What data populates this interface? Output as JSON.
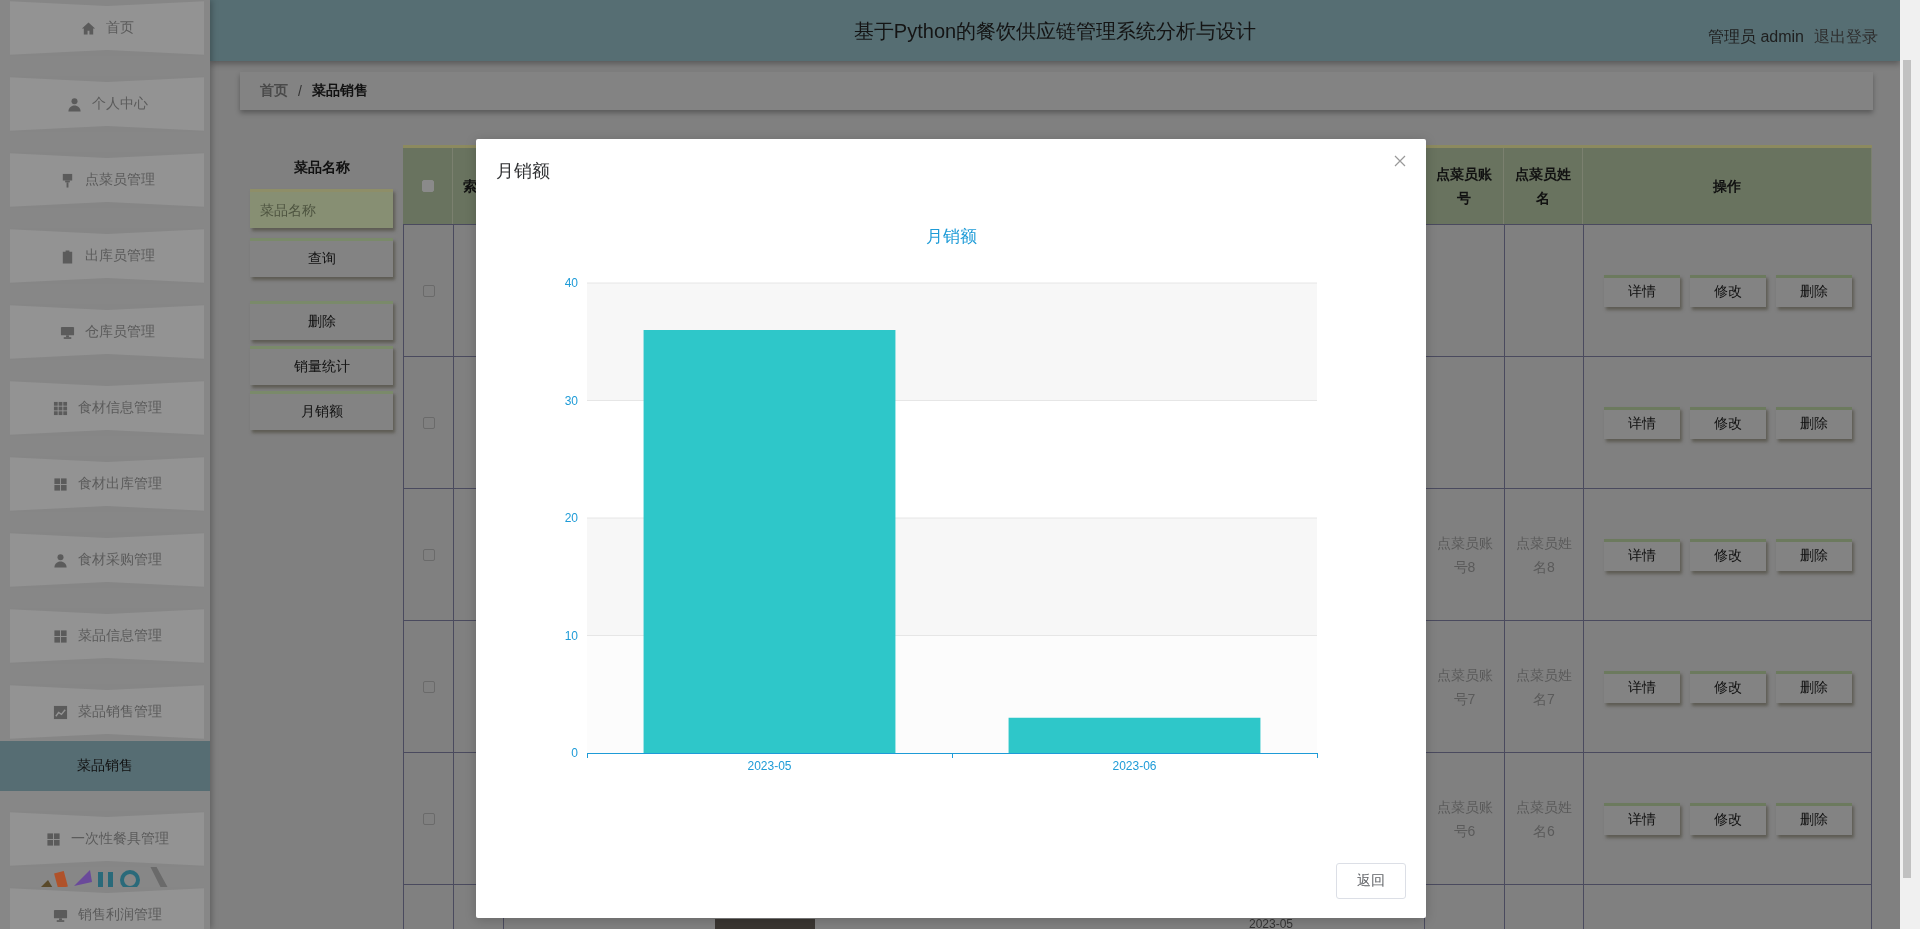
{
  "sidebar": {
    "items": [
      {
        "label": "首页",
        "selected": false
      },
      {
        "label": "个人中心",
        "selected": false
      },
      {
        "label": "点菜员管理",
        "selected": false
      },
      {
        "label": "出库员管理",
        "selected": false
      },
      {
        "label": "仓库员管理",
        "selected": false
      },
      {
        "label": "食材信息管理",
        "selected": false
      },
      {
        "label": "食材出库管理",
        "selected": false
      },
      {
        "label": "食材采购管理",
        "selected": false
      },
      {
        "label": "菜品信息管理",
        "selected": false
      },
      {
        "label": "菜品销售管理",
        "selected": false
      },
      {
        "label": "菜品销售",
        "selected": true
      },
      {
        "label": "一次性餐具管理",
        "selected": false
      },
      {
        "label": "销售利润管理",
        "selected": false
      }
    ]
  },
  "header": {
    "title": "基于Python的餐饮供应链管理系统分析与设计",
    "user": "管理员 admin",
    "logout": "退出登录"
  },
  "breadcrumb": {
    "separator": "/",
    "items": [
      {
        "label": "首页",
        "selected": false
      },
      {
        "label": "菜品销售",
        "selected": true
      }
    ]
  },
  "filter": {
    "label": "菜品名称",
    "placeholder": "菜品名称",
    "buttons": [
      "查询",
      "删除",
      "销量统计",
      "月销额"
    ]
  },
  "table": {
    "header_checked": false,
    "columns": [
      "索",
      "点菜员账号",
      "点菜员姓名",
      "操作"
    ],
    "rows": [
      {
        "checked": false,
        "actions": [
          "详情",
          "修改",
          "删除"
        ]
      },
      {
        "checked": false,
        "actions": [
          "详情",
          "修改",
          "删除"
        ]
      },
      {
        "checked": false,
        "account": "点菜员账号8",
        "name": "点菜员姓名8",
        "actions": [
          "详情",
          "修改",
          "删除"
        ]
      },
      {
        "checked": false,
        "account": "点菜员账号7",
        "name": "点菜员姓名7",
        "actions": [
          "详情",
          "修改",
          "删除"
        ]
      },
      {
        "checked": false,
        "account": "点菜员账号6",
        "name": "点菜员姓名6",
        "actions": [
          "详情",
          "修改",
          "删除"
        ]
      },
      {
        "date": "2023-05"
      }
    ]
  },
  "modal": {
    "title": "月销额",
    "button": "返回",
    "chart_data": {
      "type": "bar",
      "title": "月销额",
      "categories": [
        "2023-05",
        "2023-06"
      ],
      "values": [
        36,
        3
      ],
      "grid": true,
      "ylim": [
        0,
        40
      ],
      "yticks": [
        0,
        10,
        20,
        30,
        40
      ]
    }
  }
}
